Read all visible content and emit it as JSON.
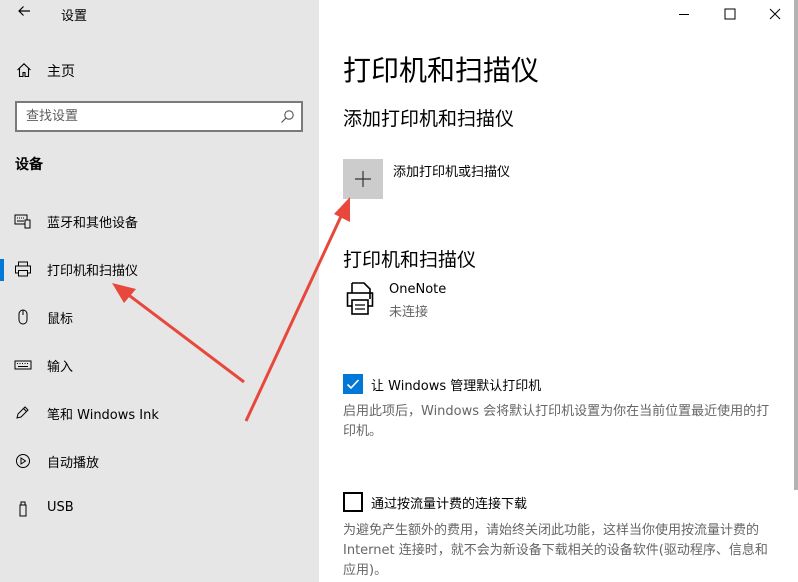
{
  "app": {
    "title": "设置"
  },
  "sidebar": {
    "home_label": "主页",
    "search_placeholder": "查找设置",
    "section_title": "设备",
    "items": [
      {
        "label": "蓝牙和其他设备",
        "icon": "bluetooth-keyboard-icon",
        "selected": false
      },
      {
        "label": "打印机和扫描仪",
        "icon": "printer-icon",
        "selected": true
      },
      {
        "label": "鼠标",
        "icon": "mouse-icon",
        "selected": false
      },
      {
        "label": "输入",
        "icon": "keyboard-icon",
        "selected": false
      },
      {
        "label": "笔和 Windows Ink",
        "icon": "pen-icon",
        "selected": false
      },
      {
        "label": "自动播放",
        "icon": "autoplay-icon",
        "selected": false
      },
      {
        "label": "USB",
        "icon": "usb-icon",
        "selected": false
      }
    ]
  },
  "main": {
    "page_title": "打印机和扫描仪",
    "add_section_title": "添加打印机和扫描仪",
    "add_button_label": "添加打印机或扫描仪",
    "list_section_title": "打印机和扫描仪",
    "printers": [
      {
        "name": "OneNote",
        "status": "未连接"
      }
    ],
    "default_printer": {
      "checked": true,
      "label": "让 Windows 管理默认打印机",
      "description": "启用此项后，Windows 会将默认打印机设置为你在当前位置最近使用的打印机。"
    },
    "metered": {
      "checked": false,
      "label": "通过按流量计费的连接下载",
      "description": "为避免产生额外的费用，请始终关闭此功能，这样当你使用按流量计费的 Internet 连接时，就不会为新设备下载相关的设备软件(驱动程序、信息和应用)。"
    }
  },
  "colors": {
    "accent": "#0078d7",
    "annotation_arrow": "#e8483c",
    "sidebar_bg": "#e6e6e6"
  }
}
